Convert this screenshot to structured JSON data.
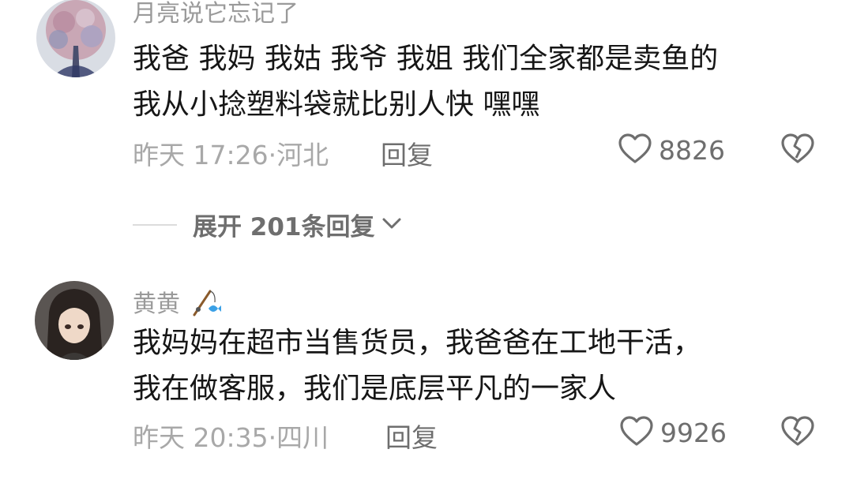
{
  "comments": [
    {
      "username": "月亮说它忘记了",
      "lines": [
        "我爸 我妈 我姑 我爷 我姐 我们全家都是卖鱼的",
        "我从小捻塑料袋就比别人快 嘿嘿"
      ],
      "time": "昨天 17:26",
      "location": "河北",
      "reply_label": "回复",
      "likes": "8826"
    },
    {
      "username": "黄黄",
      "lines": [
        "我妈妈在超市当售货员，我爸爸在工地干活，",
        "我在做客服，我们是底层平凡的一家人"
      ],
      "time": "昨天 20:35",
      "location": "四川",
      "reply_label": "回复",
      "likes": "9926"
    }
  ],
  "expand": {
    "label": "展开 201条回复"
  },
  "icons": {
    "like": "heart-outline-icon",
    "dislike": "broken-heart-icon",
    "expand": "chevron-down-icon",
    "badge": "fishing-rod-icon"
  },
  "colors": {
    "text": "#161616",
    "secondary": "#9a9a9a",
    "accent_badge": "#3aa0e6"
  }
}
